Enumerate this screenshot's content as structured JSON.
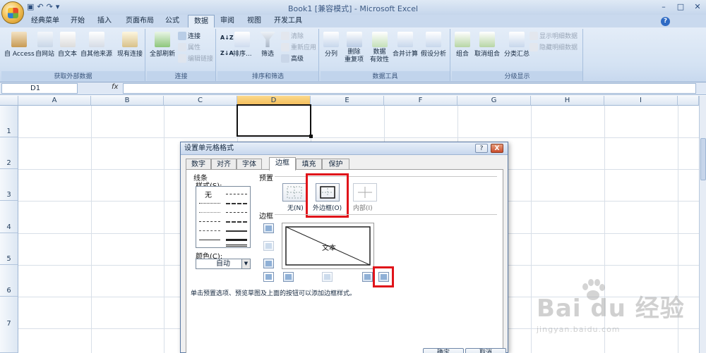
{
  "window": {
    "title": "Book1  [兼容模式] - Microsoft Excel"
  },
  "ribbon_tabs": [
    "经典菜单",
    "开始",
    "插入",
    "页面布局",
    "公式",
    "数据",
    "审阅",
    "视图",
    "开发工具"
  ],
  "active_tab": "数据",
  "groups": {
    "external": {
      "label": "获取外部数据",
      "buttons": [
        "自 Access",
        "自网站",
        "自文本",
        "自其他来源",
        "现有连接"
      ]
    },
    "connections": {
      "label": "连接",
      "refresh": "全部刷新",
      "items": [
        "连接",
        "属性",
        "编辑链接"
      ]
    },
    "sort_filter": {
      "label": "排序和筛选",
      "sort": "排序...",
      "filter": "筛选",
      "items": [
        "清除",
        "重新应用",
        "高级"
      ]
    },
    "data_tools": {
      "label": "数据工具",
      "buttons": [
        "分列",
        "删除\n重复项",
        "数据\n有效性",
        "合并计算",
        "假设分析"
      ]
    },
    "outline": {
      "label": "分级显示",
      "buttons": [
        "组合",
        "取消组合",
        "分类汇总"
      ],
      "items": [
        "显示明细数据",
        "隐藏明细数据"
      ]
    }
  },
  "formula_bar": {
    "name_box": "D1",
    "fx": "fx",
    "value": ""
  },
  "grid": {
    "columns": [
      "A",
      "B",
      "C",
      "D",
      "E",
      "F",
      "G",
      "H",
      "I"
    ],
    "rows": [
      "1",
      "2",
      "3",
      "4",
      "5",
      "6",
      "7"
    ],
    "selected_cell": "D1"
  },
  "dialog": {
    "title": "设置单元格格式",
    "help": "?",
    "close": "X",
    "tabs": [
      "数字",
      "对齐",
      "字体",
      "边框",
      "填充",
      "保护"
    ],
    "active_tab": "边框",
    "line_section": "线条",
    "style_label": "样式(S):",
    "style_none": "无",
    "color_label": "颜色(C):",
    "color_value": "自动",
    "presets_label": "预置",
    "preset_none": "无(N)",
    "preset_outline": "外边框(O)",
    "preset_inside": "内部(I)",
    "border_label": "边框",
    "preview_text": "文本",
    "hint": "单击预置选项、预览草图及上面的按钮可以添加边框样式。",
    "ok": "确定",
    "cancel": "取消"
  },
  "watermark": {
    "brand": "Bai du 经验",
    "url": "jingyan.baidu.com"
  },
  "colors": {
    "highlight_red": "#e0141a",
    "selected_column": "#f4bd5a",
    "ribbon_bg": "#d4e2f3"
  }
}
